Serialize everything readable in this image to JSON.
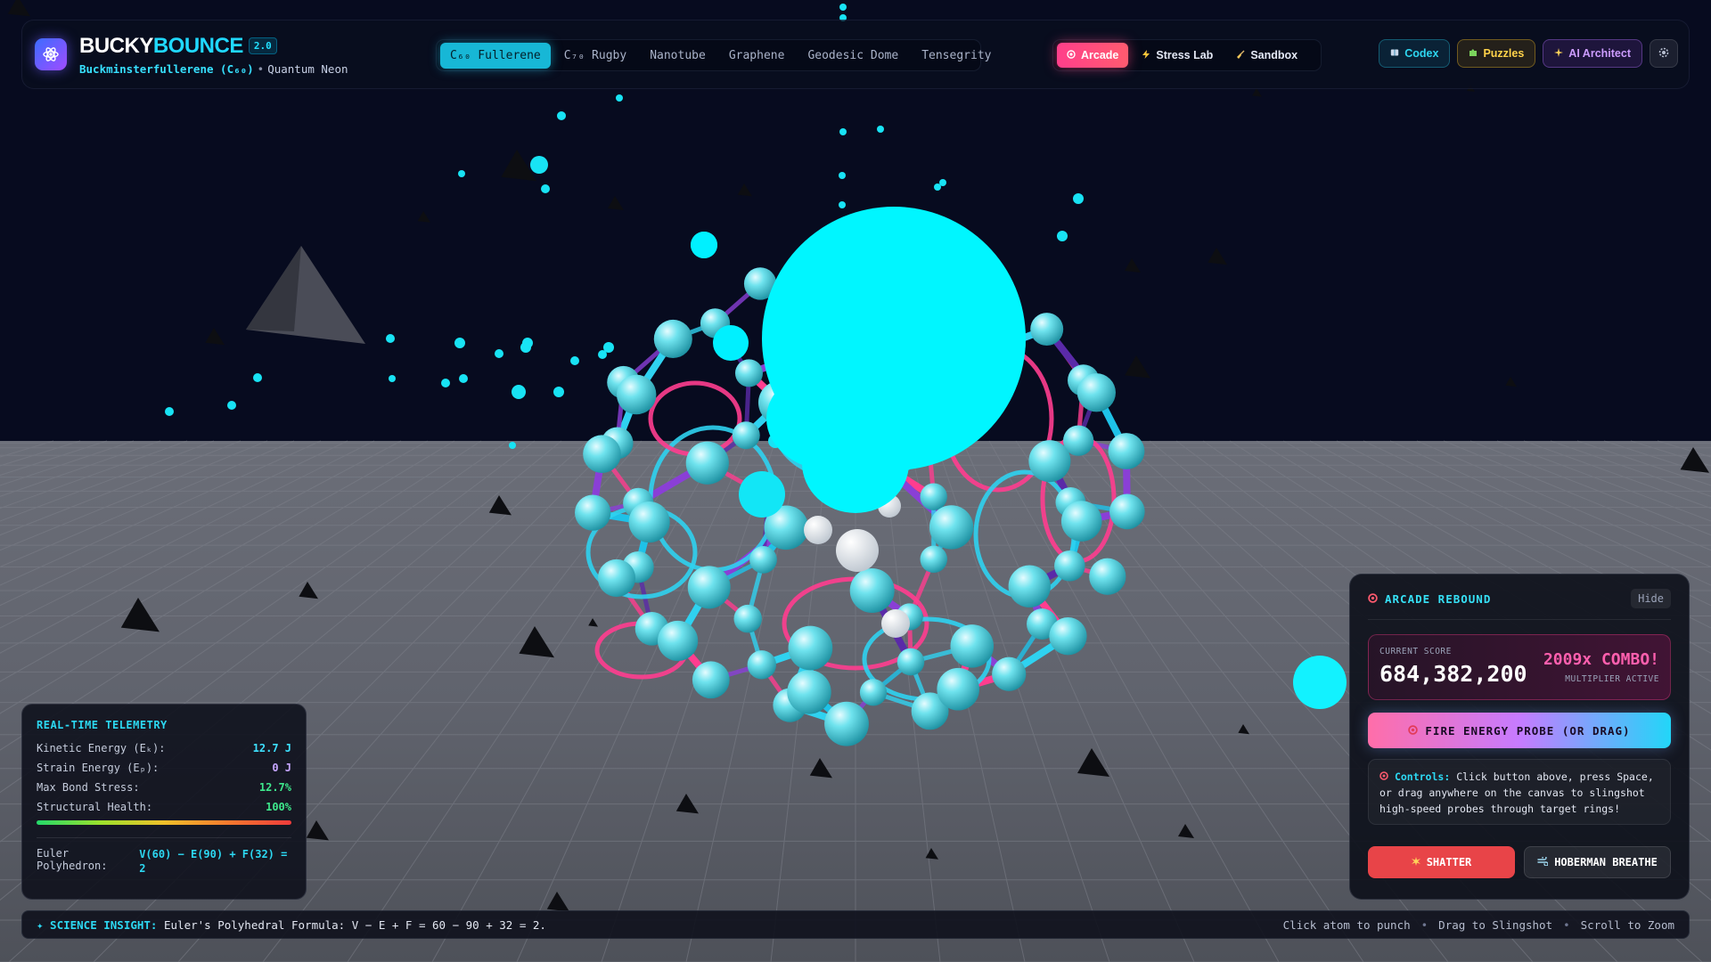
{
  "header": {
    "brand_part1": "BUCKY",
    "brand_part2": "BOUNCE",
    "version": "2.0",
    "molecule": "Buckminsterfullerene (C₆₀)",
    "separator": "•",
    "theme": "Quantum Neon",
    "structure_tabs": [
      "C₆₀ Fullerene",
      "C₇₀ Rugby",
      "Nanotube",
      "Graphene",
      "Geodesic Dome",
      "Tensegrity"
    ],
    "active_structure": "C₆₀ Fullerene",
    "mode_tabs": [
      "Arcade",
      "Stress Lab",
      "Sandbox"
    ],
    "active_mode": "Arcade",
    "codex": "Codex",
    "puzzles": "Puzzles",
    "ai_architect": "AI Architect"
  },
  "telemetry": {
    "title": "REAL-TIME TELEMETRY",
    "kinetic_label": "Kinetic Energy (Eₖ):",
    "kinetic_value": "12.7 J",
    "strain_label": "Strain Energy (Eₚ):",
    "strain_value": "0 J",
    "stress_label": "Max Bond Stress:",
    "stress_value": "12.7%",
    "health_label": "Structural Health:",
    "health_value": "100%",
    "euler_label": "Euler Polyhedron:",
    "euler_value": "V(60) − E(90) + F(32) = 2"
  },
  "arcade": {
    "title": "ARCADE REBOUND",
    "hide": "Hide",
    "score_label": "CURRENT SCORE",
    "score": "684,382,200",
    "combo": "2009x COMBO!",
    "multiplier": "MULTIPLIER ACTIVE",
    "fire_button": "FIRE ENERGY PROBE (OR DRAG)",
    "controls_label": "Controls:",
    "controls_text": "Click button above, press Space, or drag anywhere on the canvas to slingshot high-speed probes through target rings!",
    "shatter": "SHATTER",
    "breathe": "HOBERMAN BREATHE"
  },
  "footer": {
    "insight_label": "✦ SCIENCE INSIGHT:",
    "insight_text": "Euler's Polyhedral Formula: V − E + F = 60 − 90 + 32 = 2.",
    "hint1": "Click atom to punch",
    "hint2": "Drag to Slingshot",
    "hint3": "Scroll to Zoom",
    "dot": "•"
  },
  "colors": {
    "accent_cyan": "#22d8f4",
    "accent_pink": "#ff4f8f",
    "accent_violet": "#8a3fd6",
    "sky": "#060b1e",
    "floor": "#61646f"
  },
  "icons": [
    "atom-icon",
    "target-icon",
    "lightning-icon",
    "broom-icon",
    "book-icon",
    "puzzle-icon",
    "sparkle-icon",
    "settings-icon",
    "explosion-icon",
    "breathe-icon"
  ]
}
